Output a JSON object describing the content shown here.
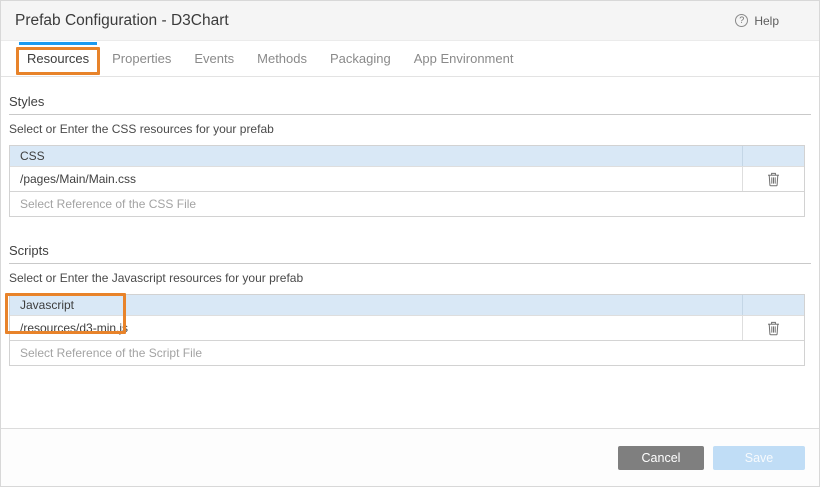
{
  "window": {
    "title": "Prefab Configuration - D3Chart"
  },
  "header": {
    "help_label": "Help",
    "help_icon_glyph": "?"
  },
  "tabs": [
    {
      "label": "Resources",
      "active": true,
      "annotated": true
    },
    {
      "label": "Properties",
      "active": false
    },
    {
      "label": "Events",
      "active": false
    },
    {
      "label": "Methods",
      "active": false
    },
    {
      "label": "Packaging",
      "active": false
    },
    {
      "label": "App Environment",
      "active": false
    }
  ],
  "sections": [
    {
      "title": "Styles",
      "description": "Select or Enter the CSS resources for your prefab",
      "table": {
        "header": "CSS",
        "rows": [
          "/pages/Main/Main.css"
        ],
        "row_action_icon": "trash-icon",
        "placeholder": "Select Reference of the CSS File"
      }
    },
    {
      "title": "Scripts",
      "description": "Select or Enter the Javascript resources for your prefab",
      "annotated": true,
      "table": {
        "header": "Javascript",
        "rows": [
          "/resources/d3-min.js"
        ],
        "row_action_icon": "trash-icon",
        "placeholder": "Select Reference of the Script File"
      }
    }
  ],
  "footer": {
    "cancel_label": "Cancel",
    "save_label": "Save"
  },
  "colors": {
    "annotation_orange": "#e8832a",
    "active_tab_indicator": "#1b9af0",
    "table_header_bg": "#d9e8f6",
    "header_bg": "#f5f5f5",
    "cancel_button_bg": "#7f7f7f",
    "save_button_bg": "#c0ddf6"
  }
}
